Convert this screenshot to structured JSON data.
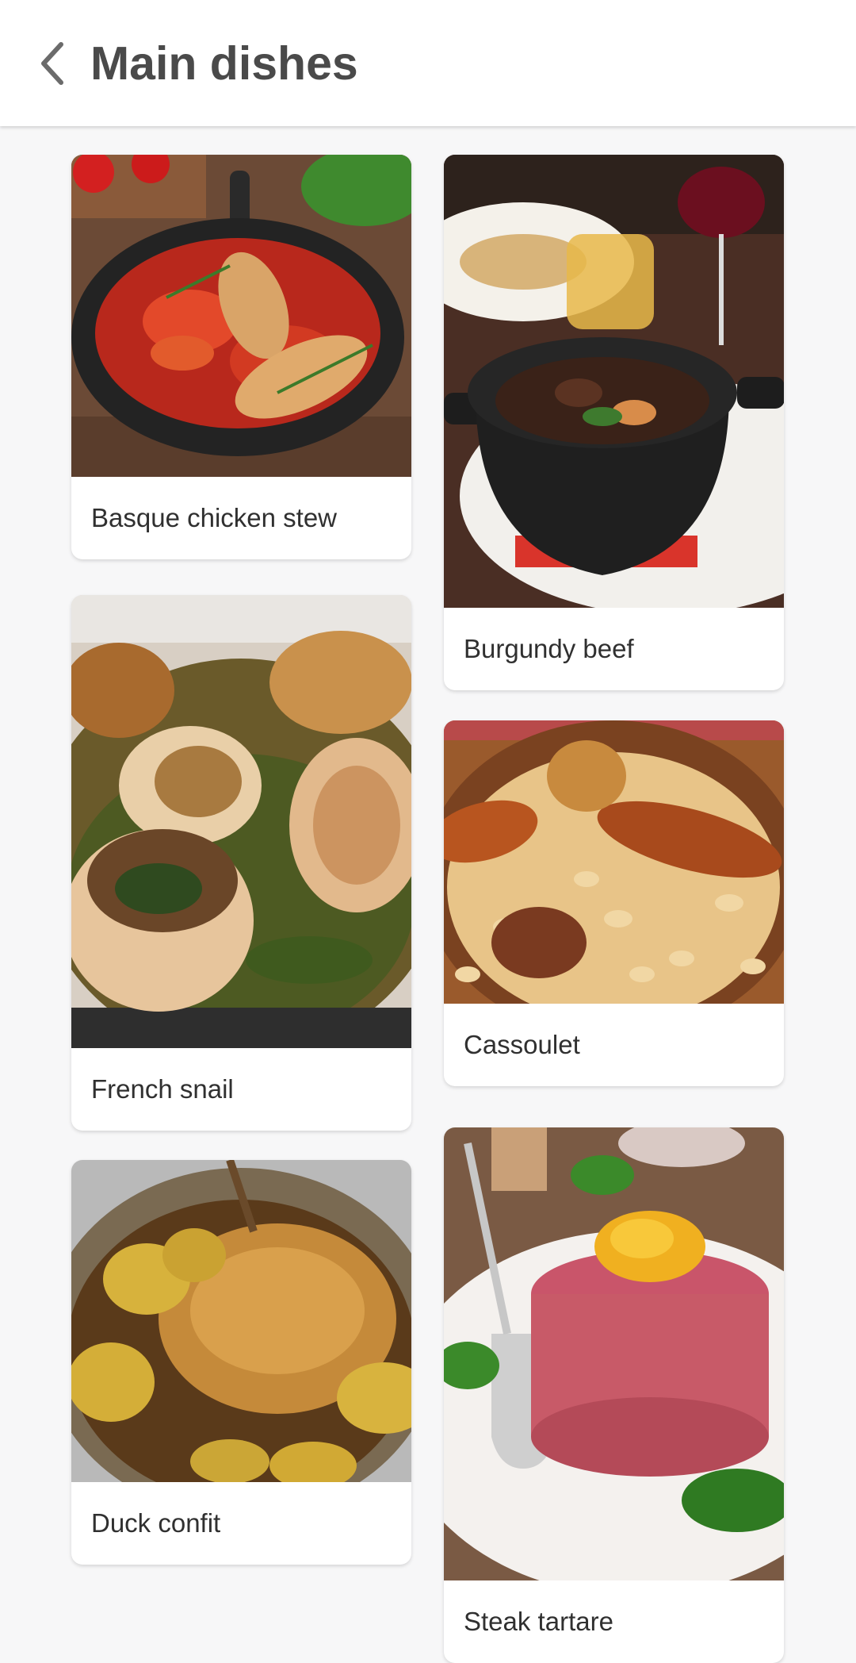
{
  "header": {
    "title": "Main dishes",
    "back_icon": "chevron-left-icon"
  },
  "dishes": [
    {
      "name": "Basque chicken stew"
    },
    {
      "name": "Burgundy beef"
    },
    {
      "name": "French snail"
    },
    {
      "name": "Cassoulet"
    },
    {
      "name": "Duck confit"
    },
    {
      "name": "Steak tartare"
    }
  ],
  "colors": {
    "background": "#f7f7f8",
    "appbar": "#ffffff",
    "title": "#4a4a4a",
    "label": "#303030"
  }
}
